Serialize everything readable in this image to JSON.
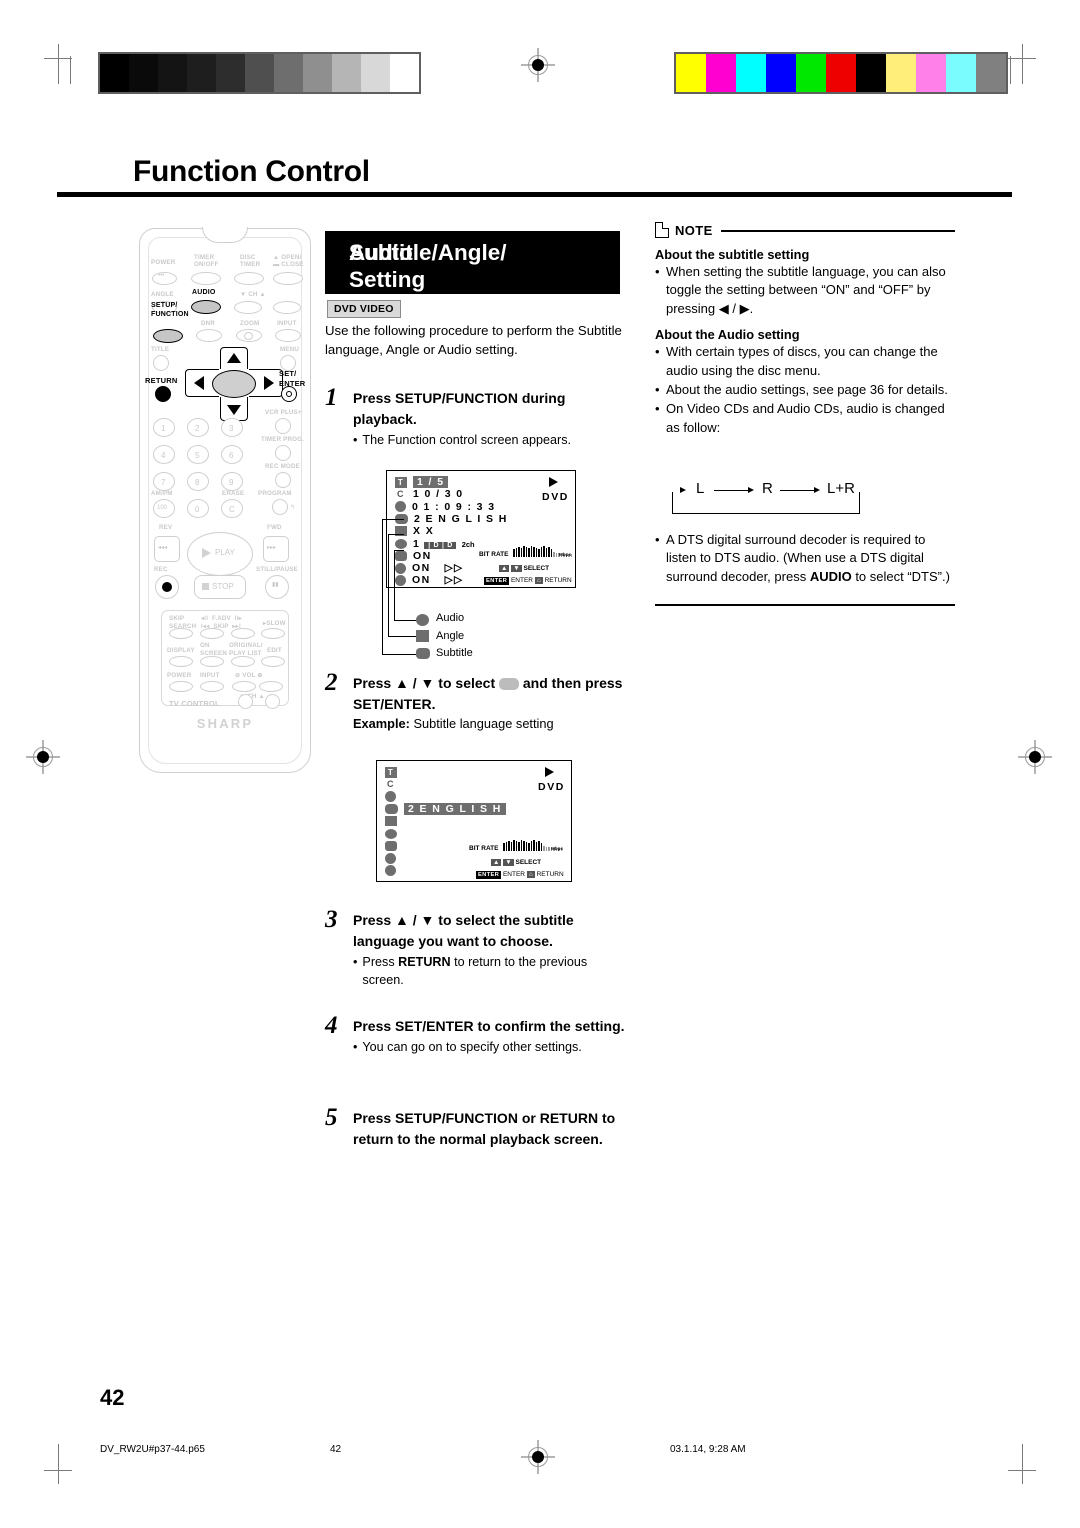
{
  "page": {
    "title": "Function Control",
    "number": "42"
  },
  "footer": {
    "filename": "DV_RW2U#p37-44.p65",
    "page": "42",
    "timestamp": "03.1.14, 9:28 AM"
  },
  "colorbars": {
    "grayscale": [
      "#000000",
      "#0a0a0a",
      "#141414",
      "#1e1e1e",
      "#2d2d2d",
      "#4f4f4f",
      "#6e6e6e",
      "#8f8f8f",
      "#b5b5b5",
      "#d8d8d8",
      "#ffffff"
    ],
    "color": [
      "#ffff00",
      "#ff00d0",
      "#00ffff",
      "#0000ff",
      "#00e800",
      "#ee0000",
      "#000000",
      "#ffee7a",
      "#ff80e8",
      "#7afcff",
      "#808080"
    ]
  },
  "remote": {
    "brand": "SHARP",
    "labels": {
      "power": "POWER",
      "timer_onoff": "TIMER\nON/OFF",
      "disc_timer": "DISC\nTIMER",
      "open_close": "OPEN/\nCLOSE",
      "angle": "ANGLE",
      "audio": "AUDIO",
      "ch": "CH",
      "setup_function": "SETUP/\nFUNCTION",
      "dnr": "DNR",
      "zoom": "ZOOM",
      "input": "INPUT",
      "title": "TITLE",
      "menu": "MENU",
      "return": "RETURN",
      "set_enter": "SET/\nENTER",
      "vcr_plus": "VCR PLUS+",
      "timer_prog": "TIMER PROG.",
      "rec_mode": "REC MODE",
      "ampm": "AM/PM",
      "erase": "ERASE",
      "program": "PROGRAM",
      "rev": "REV",
      "fwd": "FWD",
      "play": "PLAY",
      "rec": "REC",
      "stop": "STOP",
      "still_pause": "STILL/PAUSE",
      "skip_search": "SKIP\nSEARCH",
      "f_adv_skip": "F.ADV\nSKIP",
      "slow": "SLOW",
      "display": "DISPLAY",
      "on_screen": "ON\nSCREEN",
      "original_playlist": "ORIGINAL/\nPLAY LIST",
      "edit": "EDIT",
      "tv_power": "POWER",
      "tv_input": "INPUT",
      "vol": "VOL",
      "tv_ch": "CH",
      "tv_control": "TV CONTROL"
    },
    "keypad": [
      "1",
      "2",
      "3",
      "4",
      "5",
      "6",
      "7",
      "8",
      "9",
      "100",
      "0",
      "C"
    ],
    "highlighted": [
      "AUDIO",
      "SETUP/FUNCTION"
    ]
  },
  "main": {
    "heading_line1": "Subtitle/Angle/",
    "heading_line2": "Audio Setting",
    "badge": "DVD VIDEO",
    "intro": "Use the following procedure to perform the Subtitle language, Angle or Audio setting.",
    "steps": [
      {
        "num": "1",
        "head_parts": [
          {
            "t": "Press ",
            "b": false
          },
          {
            "t": "SETUP/FUNCTION",
            "b": true
          },
          {
            "t": " during playback.",
            "b": false
          }
        ],
        "bullets": [
          "The Function control screen appears."
        ]
      },
      {
        "num": "2",
        "head_parts": [
          {
            "t": "Press ▲ / ▼ to select ",
            "b": false
          },
          {
            "t": "[icon]",
            "b": false
          },
          {
            "t": " and then press ",
            "b": false
          },
          {
            "t": "SET/ENTER",
            "b": true
          },
          {
            "t": ".",
            "b": false
          }
        ],
        "example_label": "Example:",
        "example_text": " Subtitle language setting"
      },
      {
        "num": "3",
        "head_parts": [
          {
            "t": "Press ▲ / ▼ to select the subtitle language you want to choose.",
            "b": false
          }
        ],
        "bullets_rich": [
          [
            {
              "t": "Press ",
              "b": false
            },
            {
              "t": "RETURN",
              "b": true
            },
            {
              "t": " to return to the previous screen.",
              "b": false
            }
          ]
        ]
      },
      {
        "num": "4",
        "head_parts": [
          {
            "t": "Press ",
            "b": false
          },
          {
            "t": "SET/ENTER",
            "b": true
          },
          {
            "t": " to confirm the setting.",
            "b": false
          }
        ],
        "bullets": [
          "You can go on to specify other settings."
        ]
      },
      {
        "num": "5",
        "head_parts": [
          {
            "t": "Press ",
            "b": false
          },
          {
            "t": "SETUP/FUNCTION",
            "b": true
          },
          {
            "t": " or ",
            "b": false
          },
          {
            "t": "RETURN",
            "b": true
          },
          {
            "t": " to return to the normal playback screen.",
            "b": false
          }
        ]
      }
    ]
  },
  "osd1": {
    "rows": [
      {
        "icon": "title-icon",
        "label": "T",
        "value": "1 / 5",
        "highlight": true
      },
      {
        "icon": "chapter-icon",
        "label": "C",
        "value": "1 0 / 3 0",
        "highlight": false
      },
      {
        "icon": "time-icon",
        "label": "",
        "value": "0 1 : 0 9 : 3 3",
        "highlight": false
      },
      {
        "icon": "subtitle-icon",
        "label": "",
        "value": "2  E N G L I S H",
        "highlight": false
      },
      {
        "icon": "angle-icon",
        "label": "",
        "value": "X X",
        "highlight": false
      },
      {
        "icon": "audio-icon",
        "label": "",
        "value": "1",
        "extra": "2ch",
        "highlight": false
      },
      {
        "icon": "repeat-icon",
        "label": "",
        "value": "ON",
        "highlight": false
      },
      {
        "icon": "marker-icon",
        "label": "",
        "value": "ON",
        "arrow": "▷▷",
        "highlight": false
      },
      {
        "icon": "surround-icon",
        "label": "",
        "value": "ON",
        "arrow": "▷▷",
        "highlight": false
      }
    ],
    "disc_type": "DVD",
    "bitrate_label": "BIT RATE",
    "bitrate_unit": "Mbps",
    "select_label": "SELECT",
    "enter_key": "ENTER",
    "enter_label": "ENTER",
    "return_label": "RETURN",
    "dolby_mark": "D",
    "callouts": [
      "Audio",
      "Angle",
      "Subtitle"
    ]
  },
  "osd2": {
    "rows": [
      {
        "icon": "title-icon",
        "label": "T",
        "value": "",
        "highlight": false
      },
      {
        "icon": "chapter-icon",
        "label": "C",
        "value": "",
        "highlight": false
      },
      {
        "icon": "time-icon",
        "label": "",
        "value": "",
        "highlight": false
      },
      {
        "icon": "subtitle-icon",
        "label": "",
        "value": "2  E N G L I S H",
        "highlight": true
      },
      {
        "icon": "angle-icon",
        "label": "",
        "value": "",
        "highlight": false
      },
      {
        "icon": "audio-icon",
        "label": "",
        "value": "",
        "highlight": false
      },
      {
        "icon": "repeat-icon",
        "label": "",
        "value": "",
        "highlight": false
      },
      {
        "icon": "marker-icon",
        "label": "",
        "value": "",
        "highlight": false
      },
      {
        "icon": "surround-icon",
        "label": "",
        "value": "",
        "highlight": false
      }
    ],
    "disc_type": "DVD",
    "bitrate_label": "BIT RATE",
    "bitrate_unit": "Mbps",
    "select_label": "SELECT",
    "enter_key": "ENTER",
    "enter_label": "ENTER",
    "return_label": "RETURN"
  },
  "note": {
    "header": "NOTE",
    "sections": [
      {
        "title": "About the subtitle setting",
        "items": [
          [
            {
              "t": "When setting the subtitle language, you can also toggle the setting between “ON” and “OFF” by pressing ◀ / ▶.",
              "b": false
            }
          ]
        ]
      },
      {
        "title": "About the Audio setting",
        "items": [
          [
            {
              "t": "With certain types of discs, you can change the audio using the disc menu.",
              "b": false
            }
          ],
          [
            {
              "t": "About the audio settings, see page 36 for details.",
              "b": false
            }
          ],
          [
            {
              "t": "On Video CDs and Audio CDs, audio is changed as follow:",
              "b": false
            }
          ]
        ]
      }
    ],
    "audio_cycle": [
      "L",
      "R",
      "L+R"
    ],
    "dts_item": [
      {
        "t": "A DTS digital surround decoder is required to listen to DTS audio. (When use a DTS digital surround decoder, press ",
        "b": false
      },
      {
        "t": "AUDIO",
        "b": true
      },
      {
        "t": " to select “DTS”.)",
        "b": false
      }
    ]
  }
}
